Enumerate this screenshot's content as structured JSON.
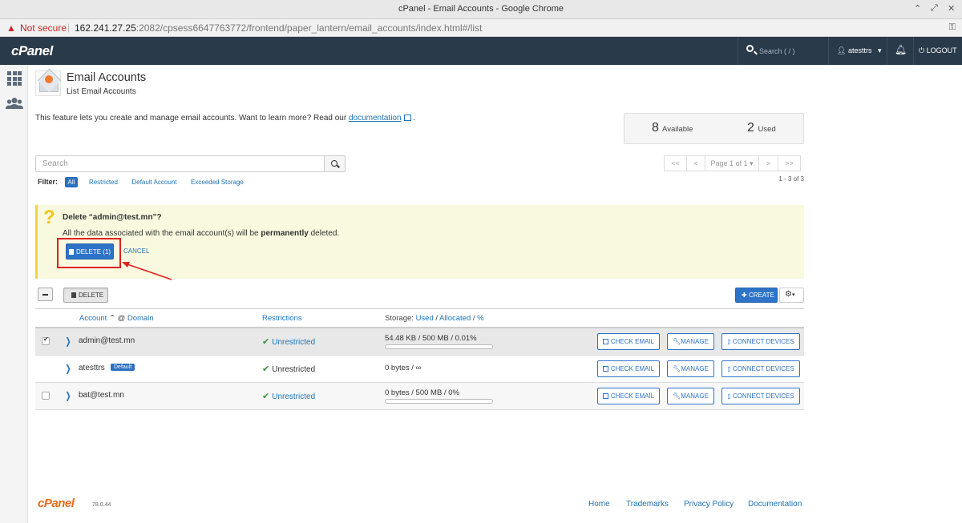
{
  "window": {
    "title": "cPanel - Email Accounts - Google Chrome",
    "controls": [
      "⌃",
      "⤢",
      "✕"
    ]
  },
  "addressbar": {
    "security": "Not secure",
    "host": "162.241.27.25",
    "path": ":2082/cpsess6647763772/frontend/paper_lantern/email_accounts/index.html#/list"
  },
  "header": {
    "logo": "cPanel",
    "search_placeholder": "Search ( / )",
    "user": "atesttrs",
    "logout": "LOGOUT"
  },
  "page": {
    "title": "Email Accounts",
    "subtitle": "List Email Accounts",
    "intro_text": "This feature lets you create and manage email accounts. Want to learn more? Read our",
    "intro_link": "documentation",
    "intro_end": "."
  },
  "stats": {
    "available_count": "8",
    "available_label": "Available",
    "used_count": "2",
    "used_label": "Used"
  },
  "search": {
    "placeholder": "Search"
  },
  "filter": {
    "label": "Filter:",
    "options": [
      "All",
      "Restricted",
      "Default Account",
      "Exceeded Storage"
    ],
    "active": "All"
  },
  "pagination": {
    "first": "<<",
    "prev": "<",
    "page": "Page 1 of 1 ▾",
    "next": ">",
    "last": ">>",
    "count": "1 - 3 of 3"
  },
  "confirm": {
    "heading": "Delete “admin@test.mn”?",
    "message_pre": "All the data associated with the email account(s) will be",
    "message_bold": "permanently",
    "message_post": "deleted.",
    "delete_label": "DELETE (1)",
    "cancel_label": "CANCEL"
  },
  "toolbar": {
    "delete_label": "DELETE",
    "create_label": "CREATE"
  },
  "table": {
    "headers": {
      "account": "Account",
      "at": "@",
      "domain": "Domain",
      "restrictions": "Restrictions",
      "storage": "Storage:",
      "used": "Used",
      "allocated": "Allocated",
      "percent": "%"
    },
    "rows": [
      {
        "account": "admin@test.mn",
        "checked": true,
        "badge": "",
        "restriction": "Unrestricted",
        "storage": "54.48 KB / 500 MB / 0.01%",
        "usage_fraction": 0.0001,
        "actions": [
          "CHECK EMAIL",
          "MANAGE",
          "CONNECT DEVICES"
        ]
      },
      {
        "account": "atesttrs",
        "checked": false,
        "badge": "Default",
        "restriction": "Unrestricted",
        "storage": "0 bytes / ∞",
        "usage_fraction": 0,
        "actions": [
          "CHECK EMAIL",
          "MANAGE",
          "CONNECT DEVICES"
        ]
      },
      {
        "account": "bat@test.mn",
        "checked": false,
        "badge": "",
        "restriction": "Unrestricted",
        "storage": "0 bytes / 500 MB / 0%",
        "usage_fraction": 0,
        "actions": [
          "CHECK EMAIL",
          "MANAGE",
          "CONNECT DEVICES"
        ]
      }
    ]
  },
  "footer": {
    "logo": "cPanel",
    "version": "78.0.44",
    "links": [
      "Home",
      "Trademarks",
      "Privacy Policy",
      "Documentation"
    ]
  },
  "colors": {
    "header_bg": "#293a4a",
    "accent": "#2d74c8",
    "confirm_bg": "#f8f9de",
    "highlight": "#e02020",
    "brand_orange": "#e86c1c"
  }
}
